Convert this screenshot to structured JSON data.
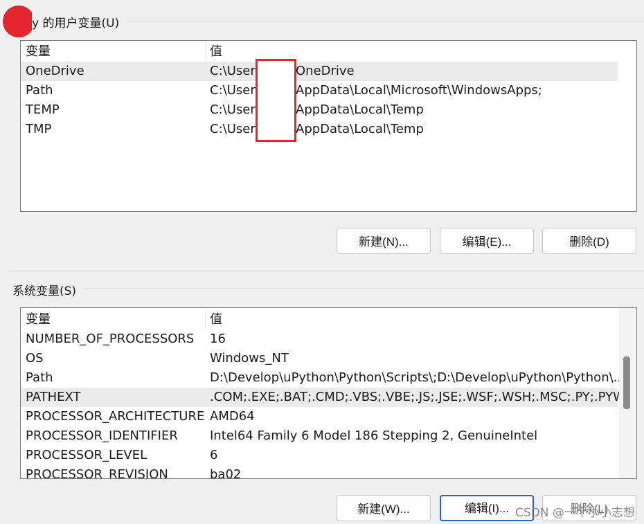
{
  "user_vars": {
    "title": "y 的用户变量(U)",
    "headers": {
      "name": "变量",
      "value": "值"
    },
    "rows": [
      {
        "name": "OneDrive",
        "prefix": "C:\\Users",
        "suffix": "OneDrive"
      },
      {
        "name": "Path",
        "prefix": "C:\\Users",
        "suffix": "AppData\\Local\\Microsoft\\WindowsApps;"
      },
      {
        "name": "TEMP",
        "prefix": "C:\\Users",
        "suffix": "AppData\\Local\\Temp"
      },
      {
        "name": "TMP",
        "prefix": "C:\\Users",
        "suffix": "AppData\\Local\\Temp"
      }
    ],
    "buttons": {
      "new": "新建(N)...",
      "edit": "编辑(E)...",
      "delete": "删除(D)"
    }
  },
  "system_vars": {
    "title": "系统变量(S)",
    "headers": {
      "name": "变量",
      "value": "值"
    },
    "rows": [
      {
        "name": "NUMBER_OF_PROCESSORS",
        "value": "16"
      },
      {
        "name": "OS",
        "value": "Windows_NT"
      },
      {
        "name": "Path",
        "value": "D:\\Develop\\uPython\\Python\\Scripts\\;D:\\Develop\\uPython\\Python\\..."
      },
      {
        "name": "PATHEXT",
        "value": ".COM;.EXE;.BAT;.CMD;.VBS;.VBE;.JS;.JSE;.WSF;.WSH;.MSC;.PY;.PYW"
      },
      {
        "name": "PROCESSOR_ARCHITECTURE",
        "value": "AMD64"
      },
      {
        "name": "PROCESSOR_IDENTIFIER",
        "value": "Intel64 Family 6 Model 186 Stepping 2, GenuineIntel"
      },
      {
        "name": "PROCESSOR_LEVEL",
        "value": "6"
      },
      {
        "name": "PROCESSOR_REVISION",
        "value": "ba02"
      }
    ],
    "buttons": {
      "new": "新建(W)...",
      "edit": "编辑(I)...",
      "delete": "删除(L)"
    }
  },
  "watermark": "CSDN @一个小小志想",
  "colors": {
    "accent": "#1f66c9",
    "redaction": "#e5252d",
    "selection": "#ebebeb"
  }
}
